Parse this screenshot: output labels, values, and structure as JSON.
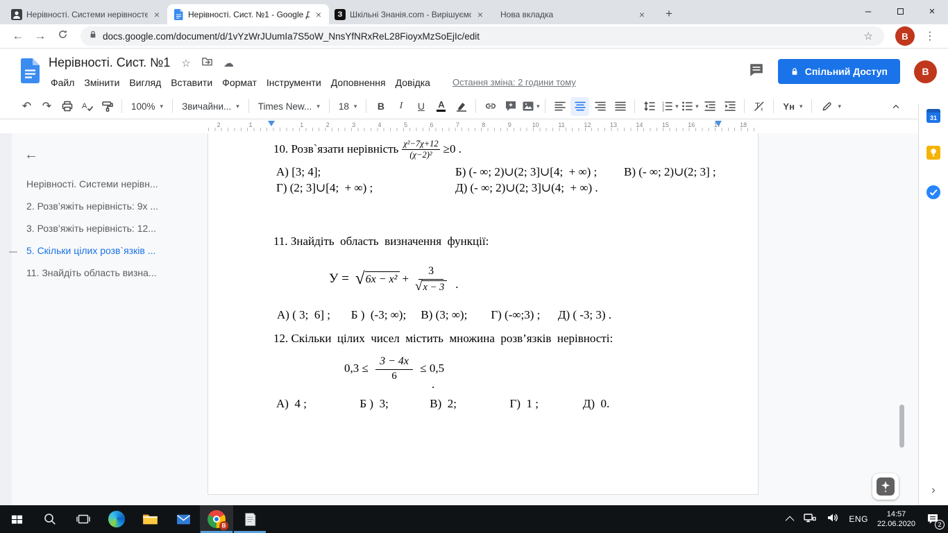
{
  "browser": {
    "tabs": [
      {
        "title": "Нерівності. Системи нерівносте",
        "active": false
      },
      {
        "title": "Нерівності. Сист. №1 - Google Д",
        "active": true
      },
      {
        "title": "Шкільні Знанія.com - Вирішуємо",
        "active": false
      },
      {
        "title": "Нова вкладка",
        "active": false
      }
    ],
    "tab3_favicon_letter": "З",
    "new_tab_glyph": "+",
    "close_glyph": "×",
    "minimize_glyph": "–",
    "back_glyph": "←",
    "forward_glyph": "→",
    "bookmark_glyph": "☆",
    "kebab_glyph": "⋮",
    "url": "docs.google.com/document/d/1vYzWrJUumIa7S5oW_NnsYfNRxReL28FioyxMzSoEjIc/edit",
    "profile_initial": "B"
  },
  "docs": {
    "title": "Нерівності. Сист. №1",
    "star_glyph": "☆",
    "cloud_glyph": "☁",
    "menus": [
      "Файл",
      "Змінити",
      "Вигляд",
      "Вставити",
      "Формат",
      "Інструменти",
      "Доповнення",
      "Довідка"
    ],
    "last_edit": "Остання зміна: 2 години тому",
    "share_label": "Спільний Доступ",
    "profile_initial": "B",
    "toolbar": {
      "undo_glyph": "↶",
      "redo_glyph": "↷",
      "spellcheck_letter": "A",
      "zoom": "100%",
      "style": "Звичайни...",
      "font": "Times New...",
      "size": "18",
      "bold": "B",
      "italic": "I",
      "underline": "U",
      "text_color_letter": "A",
      "clear_t": "T",
      "clear_x": "x",
      "input_tools": "Yн",
      "dropdown_glyph": "▾"
    }
  },
  "ruler": {
    "left_numbers": [
      "2",
      "1"
    ],
    "numbers": [
      "1",
      "2",
      "3",
      "4",
      "5",
      "6",
      "7",
      "8",
      "9",
      "10",
      "11",
      "12",
      "13",
      "14",
      "15",
      "16",
      "17",
      "18"
    ]
  },
  "outline": {
    "back_glyph": "←",
    "active_marker": "—",
    "items": [
      {
        "label": "Нерівності. Системи нерівн...",
        "active": false
      },
      {
        "label": "2. Розв’яжіть нерівність: 9x ...",
        "active": false
      },
      {
        "label": "3. Розв’яжіть нерівність: 12...",
        "active": false
      },
      {
        "label": "5. Скільки цілих розв`язків ...",
        "active": true
      },
      {
        "label": "11. Знайдіть область визна...",
        "active": false
      }
    ]
  },
  "doc": {
    "sqrt_glyph": "√",
    "q10": {
      "prefix": "10. Розв`язати нерівність",
      "num": "χ²−7χ+12",
      "den": "(χ−2)²",
      "suffix": "≥0 .",
      "a1": "А) [3; 4];",
      "a2": "Б) (- ∞; 2)∪(2; 3]∪[4;  + ∞) ;",
      "a3": "В) (- ∞; 2)∪(2; 3] ;",
      "g1": "Г) (2; 3]∪[4;  + ∞) ;",
      "d1": "Д) (- ∞; 2)∪(2; 3]∪(4;  + ∞) ."
    },
    "q11": {
      "title": "11. Знайдіть  область  визначення  функції:",
      "lhs": "У =",
      "sqrt1": "6x − x²",
      "plus": "+",
      "num": "3",
      "sqrt2": "x − 3",
      "tail": ".",
      "answers": "А) ( 3;  6] ;       Б )  (-3; ∞);     В) (3; ∞);        Г) (-∞;3) ;      Д) ( -3; 3) ."
    },
    "q12": {
      "title": "12. Скільки  цілих  чисел  містить  множина  розв’язків  нерівності:",
      "left": "0,3 ≤ ",
      "num": "3 − 4x",
      "den": "6",
      "right": " ≤ 0,5",
      "dot": ".",
      "answers": "А)  4 ;                  Б )  3;              В)  2;                  Г)  1 ;               Д)  0."
    }
  },
  "side_panel": {
    "calendar_day": "31",
    "collapse_glyph": "›"
  },
  "taskbar": {
    "language": "ENG",
    "time": "14:57",
    "date": "22.06.2020",
    "notification_count": "2",
    "chrome_badge_initial": "B"
  },
  "colors": {
    "accent_blue": "#1a73e8",
    "avatar_red": "#c0371c",
    "taskbar_underline": "#5b9fd8",
    "canvas_gray": "#f8f9fa"
  }
}
